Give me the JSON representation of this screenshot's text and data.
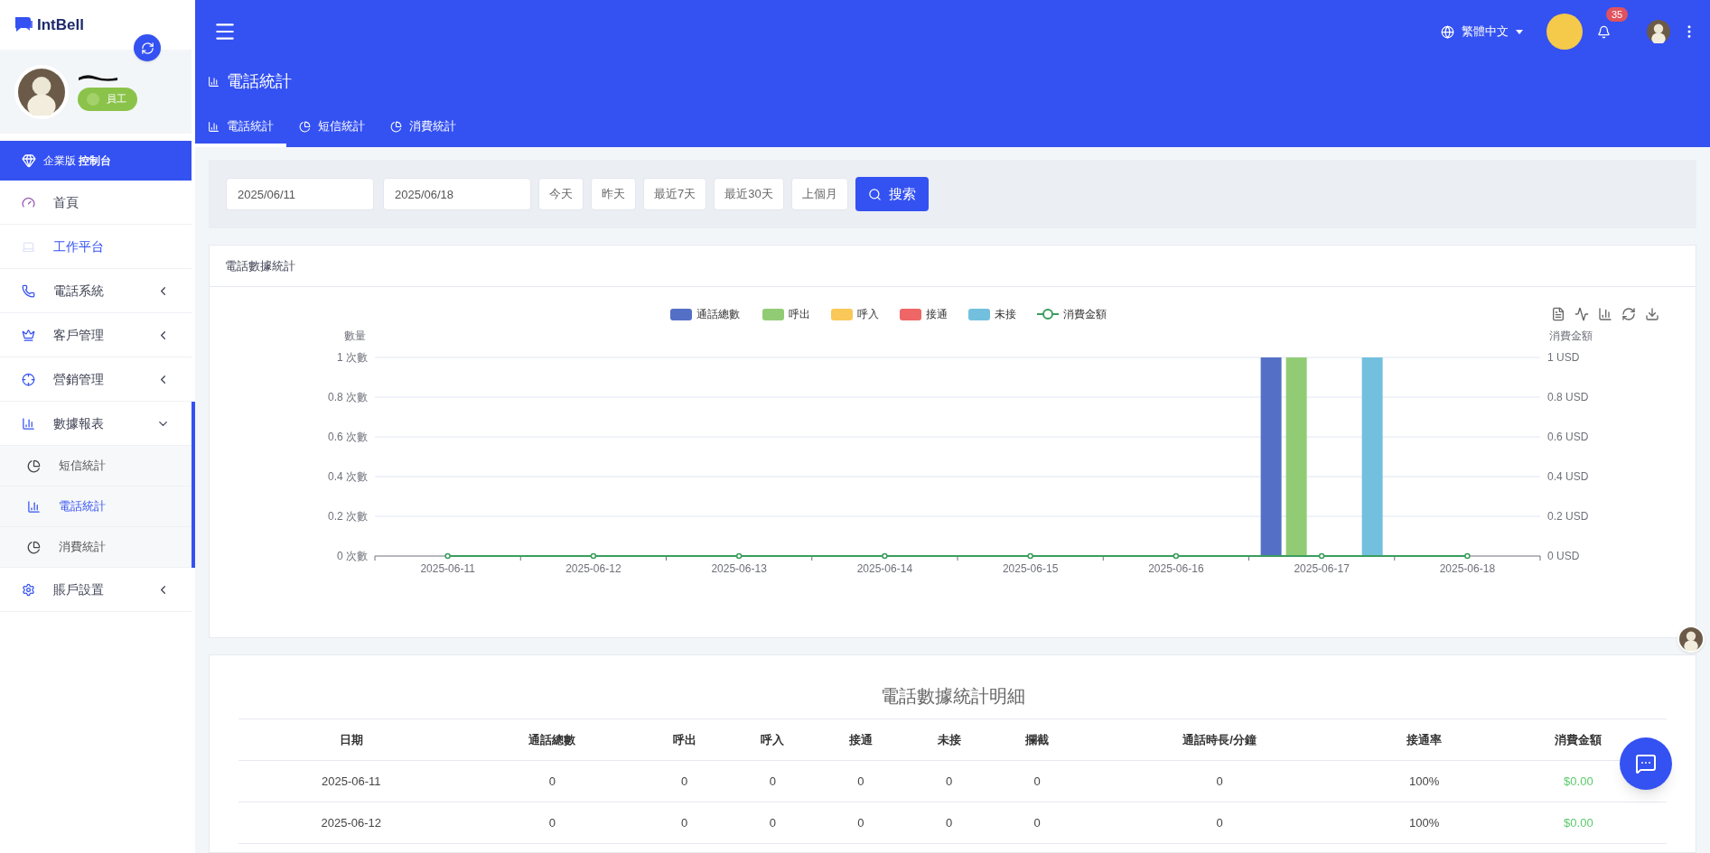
{
  "sidebar": {
    "logo": "IntBell",
    "profile": {
      "role": "員工"
    },
    "banner": {
      "edition": "企業版",
      "title": "控制台"
    },
    "items": [
      {
        "label": "首頁",
        "selected": false,
        "expanded": false,
        "has_children": false
      },
      {
        "label": "工作平台",
        "selected": true,
        "expanded": false,
        "has_children": false
      },
      {
        "label": "電話系統",
        "selected": false,
        "expanded": false,
        "has_children": true
      },
      {
        "label": "客戶管理",
        "selected": false,
        "expanded": false,
        "has_children": true
      },
      {
        "label": "營銷管理",
        "selected": false,
        "expanded": false,
        "has_children": true
      },
      {
        "label": "數據報表",
        "selected": false,
        "expanded": true,
        "has_children": true,
        "children": [
          {
            "label": "短信統計",
            "selected": false
          },
          {
            "label": "電話統計",
            "selected": true
          },
          {
            "label": "消費統計",
            "selected": false
          }
        ]
      },
      {
        "label": "賬戶設置",
        "selected": false,
        "expanded": false,
        "has_children": true
      }
    ]
  },
  "topbar": {
    "language": "繁體中文",
    "notifications": "35"
  },
  "page_title": "電話統計",
  "tabs": [
    {
      "label": "電話統計",
      "selected": true
    },
    {
      "label": "短信統計",
      "selected": false
    },
    {
      "label": "消費統計",
      "selected": false
    }
  ],
  "filter": {
    "start_date": "2025/06/11",
    "end_date": "2025/06/18",
    "quick_ranges": [
      "今天",
      "昨天",
      "最近7天",
      "最近30天",
      "上個月"
    ],
    "search_button": "搜索"
  },
  "chart_card": {
    "title": "電話數據統計",
    "chart_data": {
      "type": "bar",
      "ylabel": "數量",
      "y2label": "消費金額",
      "grid": true,
      "legend": true,
      "categories": [
        "2025-06-11",
        "2025-06-12",
        "2025-06-13",
        "2025-06-14",
        "2025-06-15",
        "2025-06-16",
        "2025-06-17",
        "2025-06-18"
      ],
      "ylim": [
        0,
        1
      ],
      "y2lim": [
        0,
        1
      ],
      "yticks": [
        {
          "value": 0,
          "label": "0 次數"
        },
        {
          "value": 0.2,
          "label": "0.2 次數"
        },
        {
          "value": 0.4,
          "label": "0.4 次數"
        },
        {
          "value": 0.6,
          "label": "0.6 次數"
        },
        {
          "value": 0.8,
          "label": "0.8 次數"
        },
        {
          "value": 1,
          "label": "1 次數"
        }
      ],
      "y2ticks": [
        {
          "value": 0,
          "label": "0 USD"
        },
        {
          "value": 0.2,
          "label": "0.2 USD"
        },
        {
          "value": 0.4,
          "label": "0.4 USD"
        },
        {
          "value": 0.6,
          "label": "0.6 USD"
        },
        {
          "value": 0.8,
          "label": "0.8 USD"
        },
        {
          "value": 1,
          "label": "1 USD"
        }
      ],
      "series": [
        {
          "name": "通話總數",
          "type": "bar",
          "color": "#5470c6",
          "values": [
            0,
            0,
            0,
            0,
            0,
            0,
            1,
            0
          ]
        },
        {
          "name": "呼出",
          "type": "bar",
          "color": "#91cc75",
          "values": [
            0,
            0,
            0,
            0,
            0,
            0,
            1,
            0
          ]
        },
        {
          "name": "呼入",
          "type": "bar",
          "color": "#fac858",
          "values": [
            0,
            0,
            0,
            0,
            0,
            0,
            0,
            0
          ]
        },
        {
          "name": "接通",
          "type": "bar",
          "color": "#ee6666",
          "values": [
            0,
            0,
            0,
            0,
            0,
            0,
            0,
            0
          ]
        },
        {
          "name": "未接",
          "type": "bar",
          "color": "#73c0de",
          "values": [
            0,
            0,
            0,
            0,
            0,
            0,
            1,
            0
          ]
        },
        {
          "name": "消費金額",
          "type": "line",
          "marker": "circle",
          "color": "#3a9d5d",
          "values": [
            0,
            0,
            0,
            0,
            0,
            0,
            0,
            0
          ]
        }
      ]
    }
  },
  "table": {
    "title": "電話數據統計明細",
    "columns": [
      "日期",
      "通話總數",
      "呼出",
      "呼入",
      "接通",
      "未接",
      "攔截",
      "通話時長/分鐘",
      "接通率",
      "消費金額"
    ],
    "rows": [
      [
        "2025-06-11",
        "0",
        "0",
        "0",
        "0",
        "0",
        "0",
        "0",
        "100%",
        "$0.00"
      ],
      [
        "2025-06-12",
        "0",
        "0",
        "0",
        "0",
        "0",
        "0",
        "0",
        "100%",
        "$0.00"
      ]
    ]
  }
}
